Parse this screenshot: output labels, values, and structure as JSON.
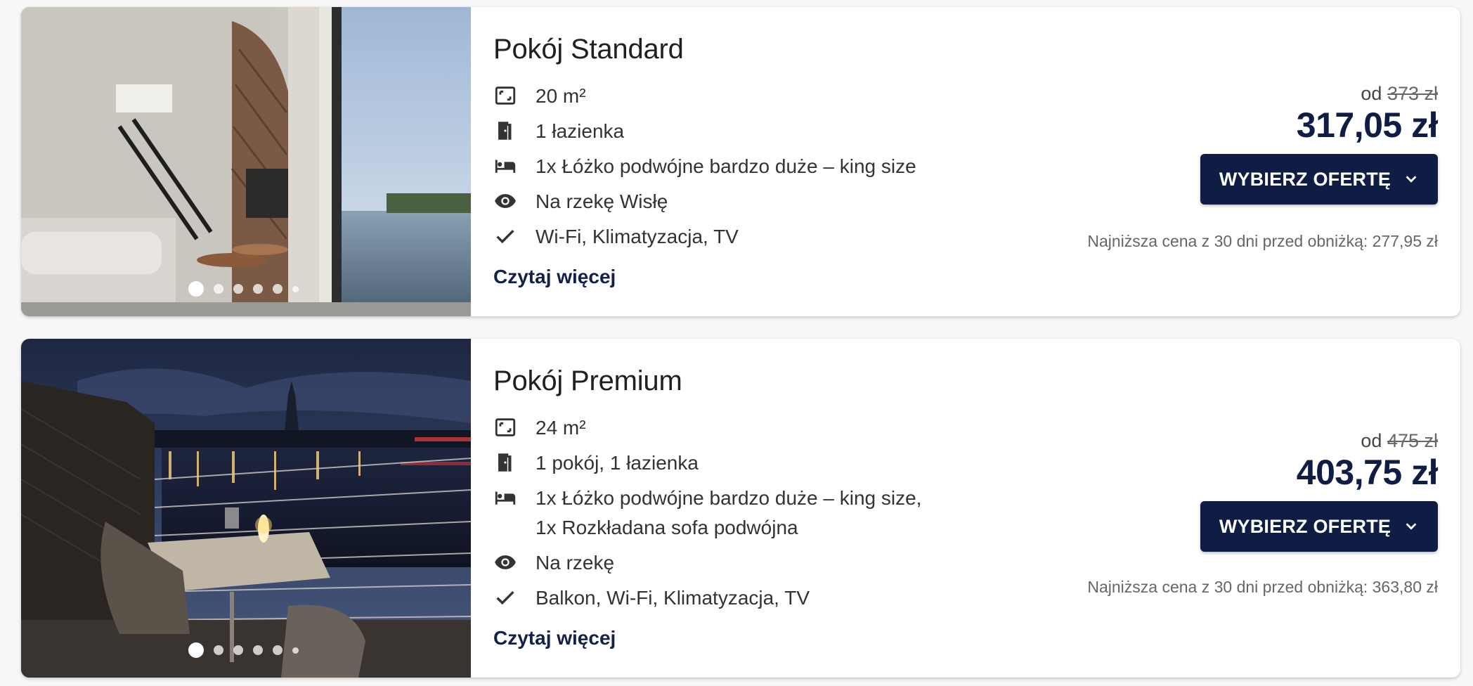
{
  "rooms": [
    {
      "title": "Pokój Standard",
      "features": [
        {
          "icon": "area-icon",
          "text": "20 m²"
        },
        {
          "icon": "door-icon",
          "text": "1 łazienka"
        },
        {
          "icon": "bed-icon",
          "text": "1x Łóżko podwójne bardzo duże – king size"
        },
        {
          "icon": "eye-icon",
          "text": "Na rzekę Wisłę"
        },
        {
          "icon": "check-icon",
          "text": "Wi-Fi, Klimatyzacja, TV"
        }
      ],
      "read_more": "Czytaj więcej",
      "price_prefix": "od",
      "old_price": "373 zł",
      "price": "317,05 zł",
      "button_label": "WYBIERZ OFERTĘ",
      "lowest_price_note": "Najniższa cena z 30 dni przed obniżką: 277,95 zł",
      "photo_count": 6,
      "active_photo": 0
    },
    {
      "title": "Pokój Premium",
      "features": [
        {
          "icon": "area-icon",
          "text": "24 m²"
        },
        {
          "icon": "door-icon",
          "text": "1 pokój, 1 łazienka"
        },
        {
          "icon": "bed-icon",
          "text": "1x Łóżko podwójne bardzo duże – king size,",
          "text2": "1x Rozkładana sofa podwójna"
        },
        {
          "icon": "eye-icon",
          "text": "Na rzekę"
        },
        {
          "icon": "check-icon",
          "text": "Balkon, Wi-Fi, Klimatyzacja, TV"
        }
      ],
      "read_more": "Czytaj więcej",
      "price_prefix": "od",
      "old_price": "475 zł",
      "price": "403,75 zł",
      "button_label": "WYBIERZ OFERTĘ",
      "lowest_price_note": "Najniższa cena z 30 dni przed obniżką: 363,80 zł",
      "photo_count": 6,
      "active_photo": 0
    }
  ],
  "colors": {
    "brand": "#0f1d45",
    "text": "#222222",
    "muted": "#666666"
  }
}
